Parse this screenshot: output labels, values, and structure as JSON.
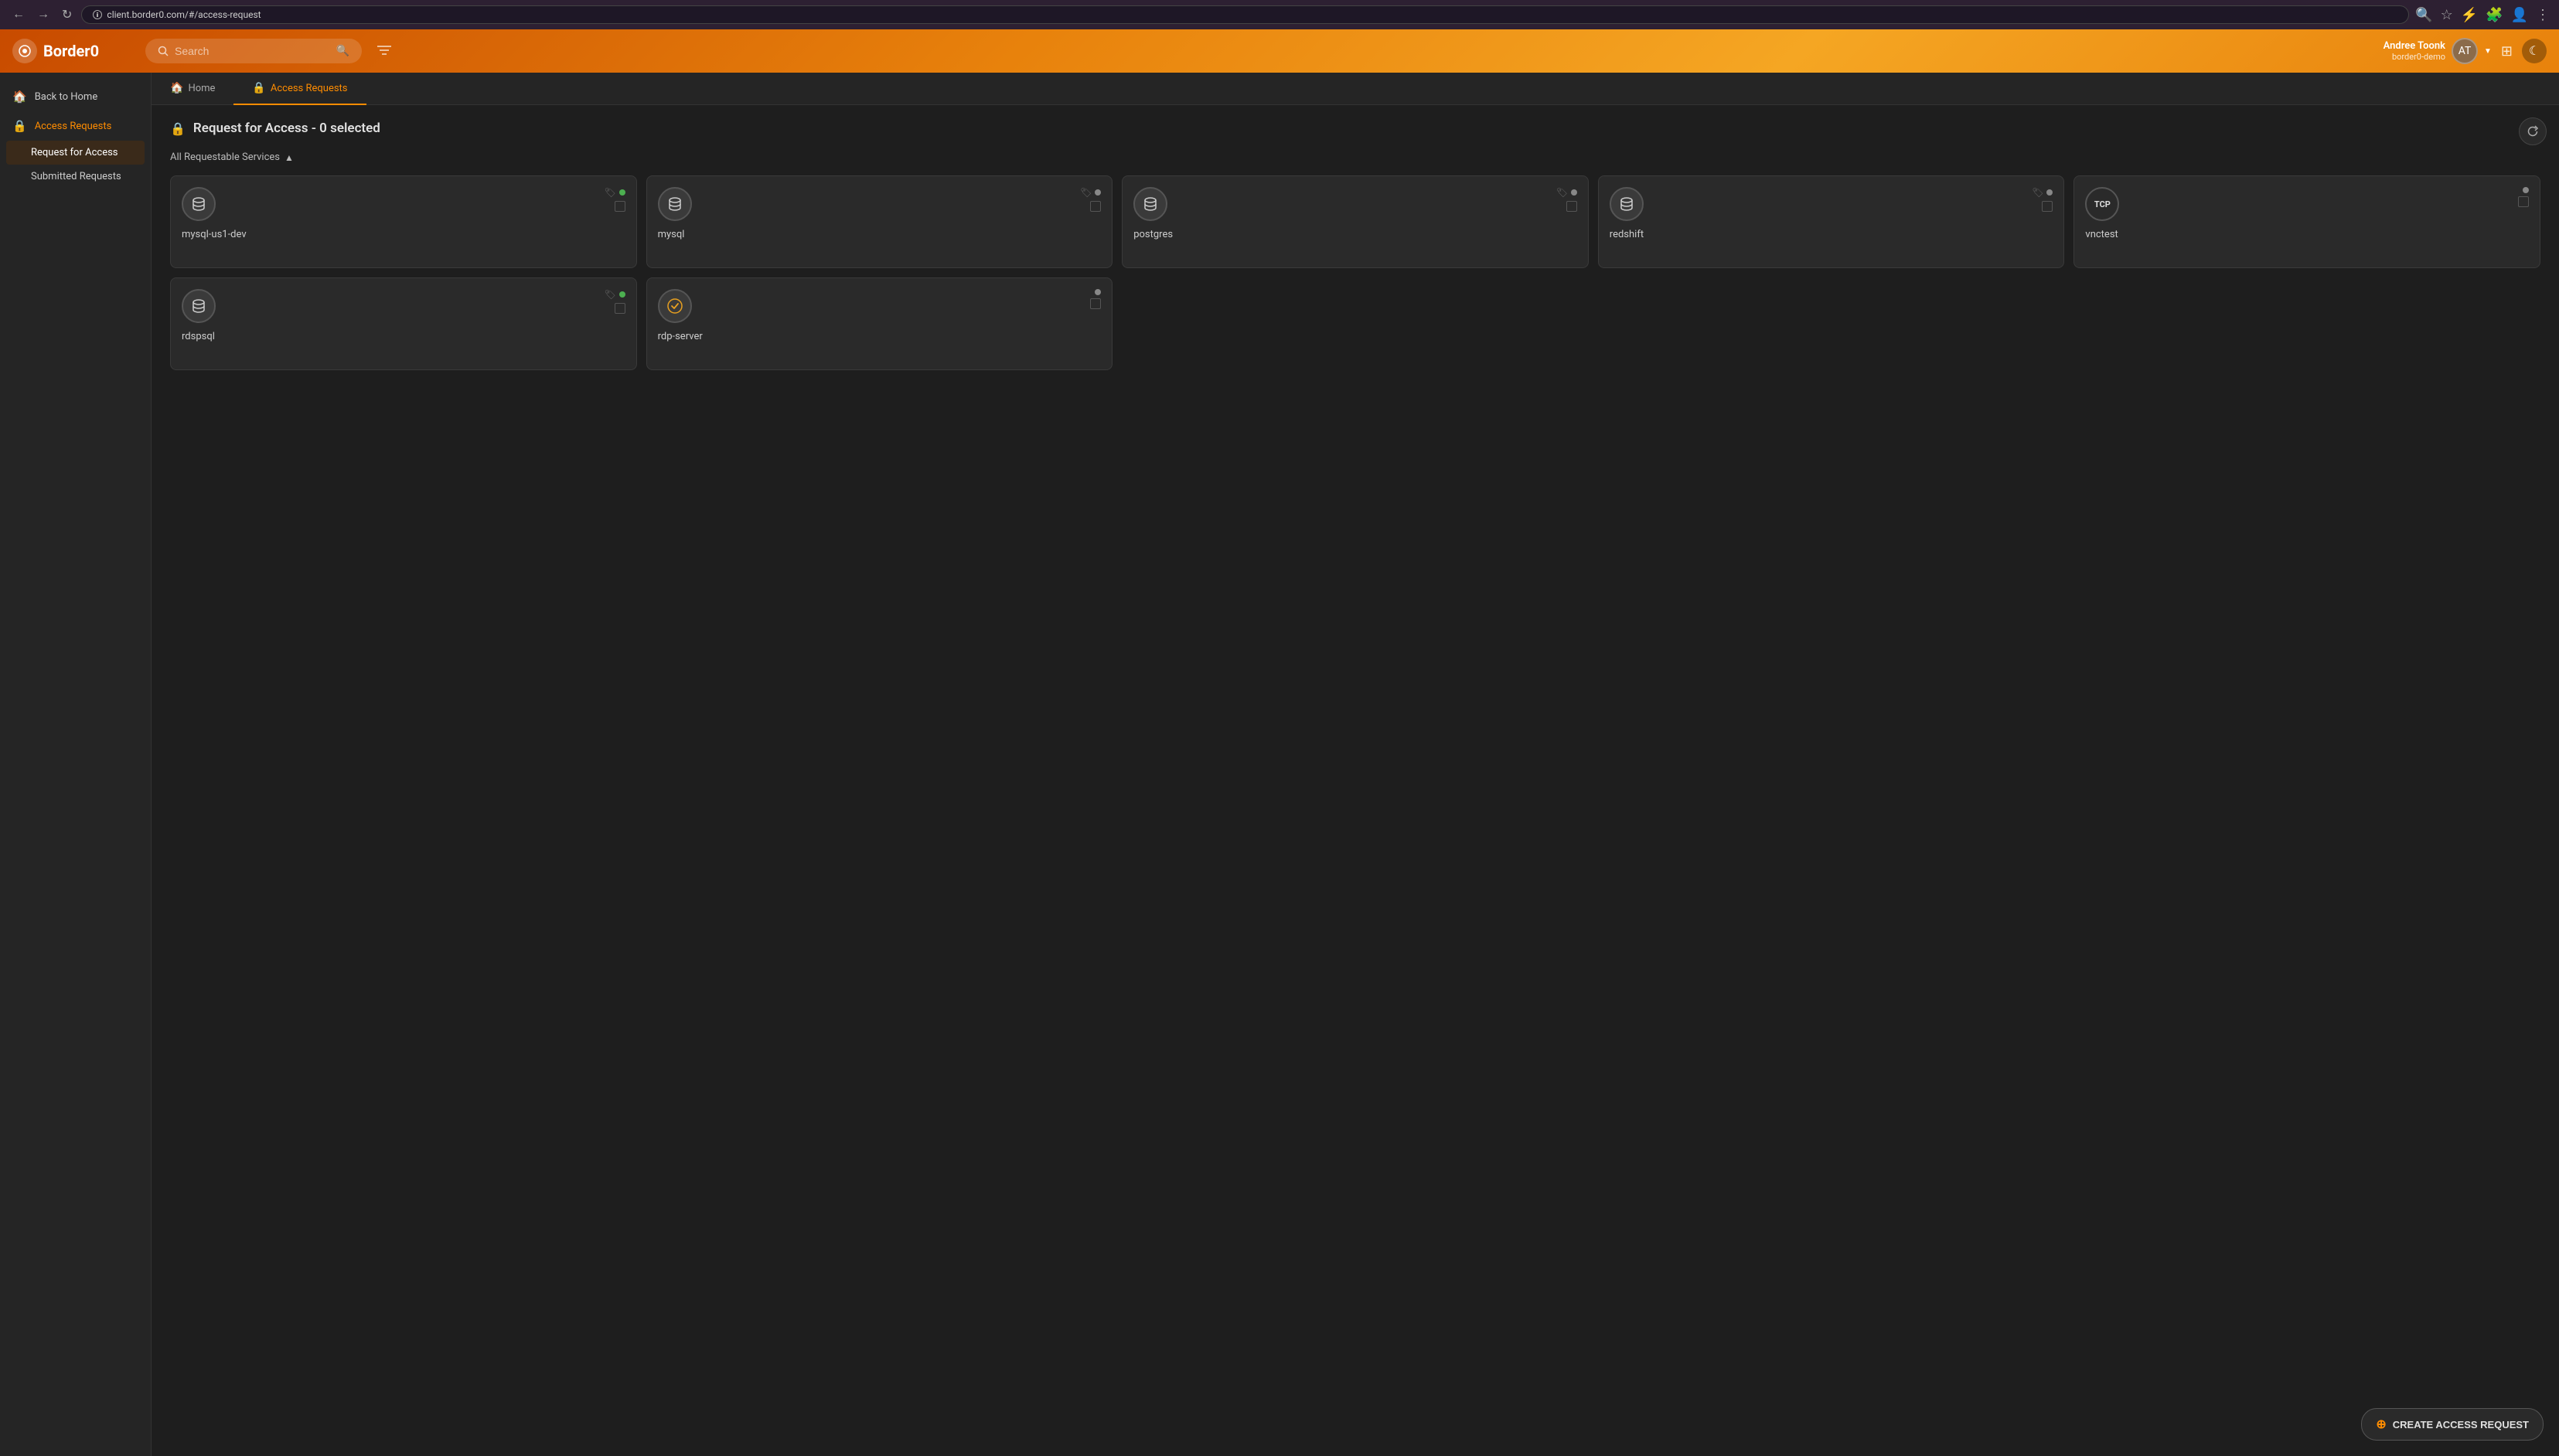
{
  "browser": {
    "url": "client.border0.com/#/access-request",
    "back_btn": "←",
    "forward_btn": "→",
    "reload_btn": "↻"
  },
  "header": {
    "logo_text": "Border0",
    "search_placeholder": "Search",
    "filter_icon": "≡",
    "user_name": "Andree Toonk",
    "user_org": "border0-demo",
    "grid_icon": "⊞",
    "moon_icon": "☾"
  },
  "tabs": [
    {
      "id": "home",
      "label": "Home",
      "icon": "🏠",
      "active": false
    },
    {
      "id": "access-requests",
      "label": "Access Requests",
      "icon": "🔒",
      "active": true
    }
  ],
  "sidebar": {
    "items": [
      {
        "id": "back-to-home",
        "label": "Back to Home",
        "icon": "🏠",
        "active": false
      },
      {
        "id": "access-requests",
        "label": "Access Requests",
        "icon": "🔒",
        "active": true
      }
    ],
    "sub_items": [
      {
        "id": "request-for-access",
        "label": "Request for Access",
        "active": true
      },
      {
        "id": "submitted-requests",
        "label": "Submitted Requests",
        "active": false
      }
    ]
  },
  "page": {
    "title": "Request for Access - 0 selected",
    "title_icon": "🔒",
    "section_label": "All Requestable Services",
    "refresh_icon": "↻"
  },
  "services_row1": [
    {
      "id": "mysql-us1-dev",
      "name": "mysql-us1-dev",
      "icon": "db",
      "type": "database",
      "status": "online",
      "tag": true
    },
    {
      "id": "mysql",
      "name": "mysql",
      "icon": "db",
      "type": "database",
      "status": "offline",
      "tag": true
    },
    {
      "id": "postgres",
      "name": "postgres",
      "icon": "db",
      "type": "database",
      "status": "offline",
      "tag": true
    },
    {
      "id": "redshift",
      "name": "redshift",
      "icon": "db",
      "type": "database",
      "status": "offline",
      "tag": true
    },
    {
      "id": "vnctest",
      "name": "vnctest",
      "icon": "tcp",
      "type": "tcp",
      "status": "offline",
      "tag": false
    }
  ],
  "services_row2": [
    {
      "id": "rdspsql",
      "name": "rdspsql",
      "icon": "db",
      "type": "database",
      "status": "online",
      "tag": true
    },
    {
      "id": "rdp-server",
      "name": "rdp-server",
      "icon": "rdp",
      "type": "rdp",
      "status": "offline",
      "tag": false
    }
  ],
  "create_button": {
    "label": "CREATE ACCESS REQUEST",
    "icon": "⊕"
  }
}
